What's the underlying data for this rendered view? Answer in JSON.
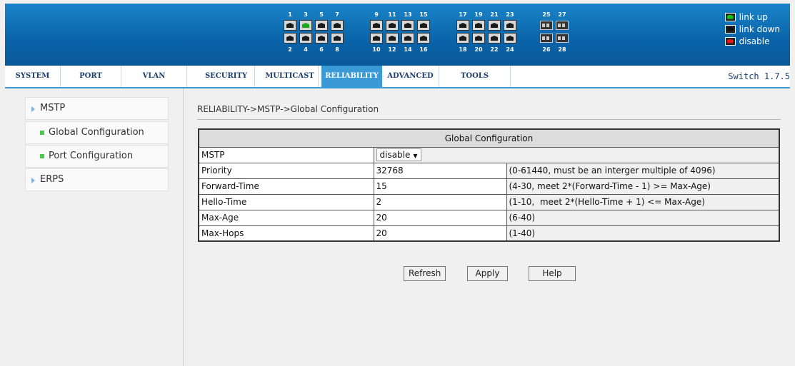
{
  "banner": {
    "group1_top": [
      "1",
      "3",
      "5",
      "7"
    ],
    "group1_bottom": [
      "2",
      "4",
      "6",
      "8"
    ],
    "group2_top": [
      "9",
      "11",
      "13",
      "15"
    ],
    "group2_bottom": [
      "10",
      "12",
      "14",
      "16"
    ],
    "group3_top": [
      "17",
      "19",
      "21",
      "23"
    ],
    "group3_bottom": [
      "18",
      "20",
      "22",
      "24"
    ],
    "group4_top": [
      "25",
      "27"
    ],
    "group4_bottom": [
      "26",
      "28"
    ],
    "link_up_ports": [
      "3"
    ],
    "legend": {
      "link_up": "link up",
      "link_down": "link down",
      "disable": "disable"
    }
  },
  "menu": {
    "items": [
      "SYSTEM",
      "PORT",
      "VLAN",
      "SECURITY",
      "MULTICAST",
      "RELIABILITY",
      "ADVANCED",
      "TOOLS"
    ],
    "active": "RELIABILITY",
    "version": "Switch 1.7.5"
  },
  "sidebar": {
    "items": [
      "MSTP",
      "Global Configuration",
      "Port Configuration",
      "ERPS"
    ]
  },
  "content": {
    "breadcrumb": "RELIABILITY->MSTP->Global Configuration",
    "table_title": "Global Configuration",
    "rows": [
      {
        "label": "MSTP",
        "value": "disable",
        "hint": ""
      },
      {
        "label": "Priority",
        "value": "32768",
        "hint": "(0-61440, must be an interger multiple of 4096)"
      },
      {
        "label": "Forward-Time",
        "value": "15",
        "hint": "(4-30, meet 2*(Forward-Time - 1) >= Max-Age)"
      },
      {
        "label": "Hello-Time",
        "value": "2",
        "hint": "(1-10,  meet 2*(Hello-Time + 1) <= Max-Age)"
      },
      {
        "label": "Max-Age",
        "value": "20",
        "hint": "(6-40)"
      },
      {
        "label": "Max-Hops",
        "value": "20",
        "hint": "(1-40)"
      }
    ],
    "buttons": {
      "refresh": "Refresh",
      "apply": "Apply",
      "help": "Help"
    }
  },
  "colors": {
    "banner": "#0a63a8",
    "menu_active": "#3a9ad6",
    "link_up": "#19c419",
    "disable": "#e01818"
  }
}
